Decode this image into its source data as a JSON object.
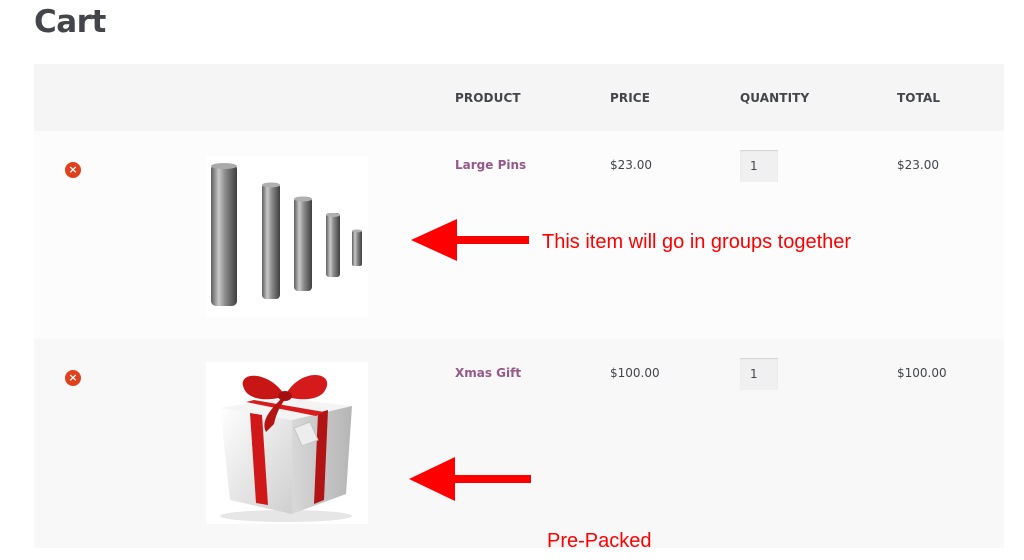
{
  "page": {
    "title": "Cart"
  },
  "table": {
    "headers": {
      "product": "PRODUCT",
      "price": "PRICE",
      "quantity": "QUANTITY",
      "total": "TOTAL"
    }
  },
  "items": [
    {
      "name": "Large Pins",
      "price": "$23.00",
      "quantity": "1",
      "total": "$23.00",
      "remove_icon": "remove-x-icon",
      "annotation": "This item will go in groups together"
    },
    {
      "name": "Xmas Gift",
      "price": "$100.00",
      "quantity": "1",
      "total": "$100.00",
      "remove_icon": "remove-x-icon",
      "annotation": "Pre-Packed"
    }
  ],
  "colors": {
    "accent_link": "#96588a",
    "remove": "#e2401c",
    "annotation": "#ff0000",
    "header_bg": "#f5f5f5"
  }
}
